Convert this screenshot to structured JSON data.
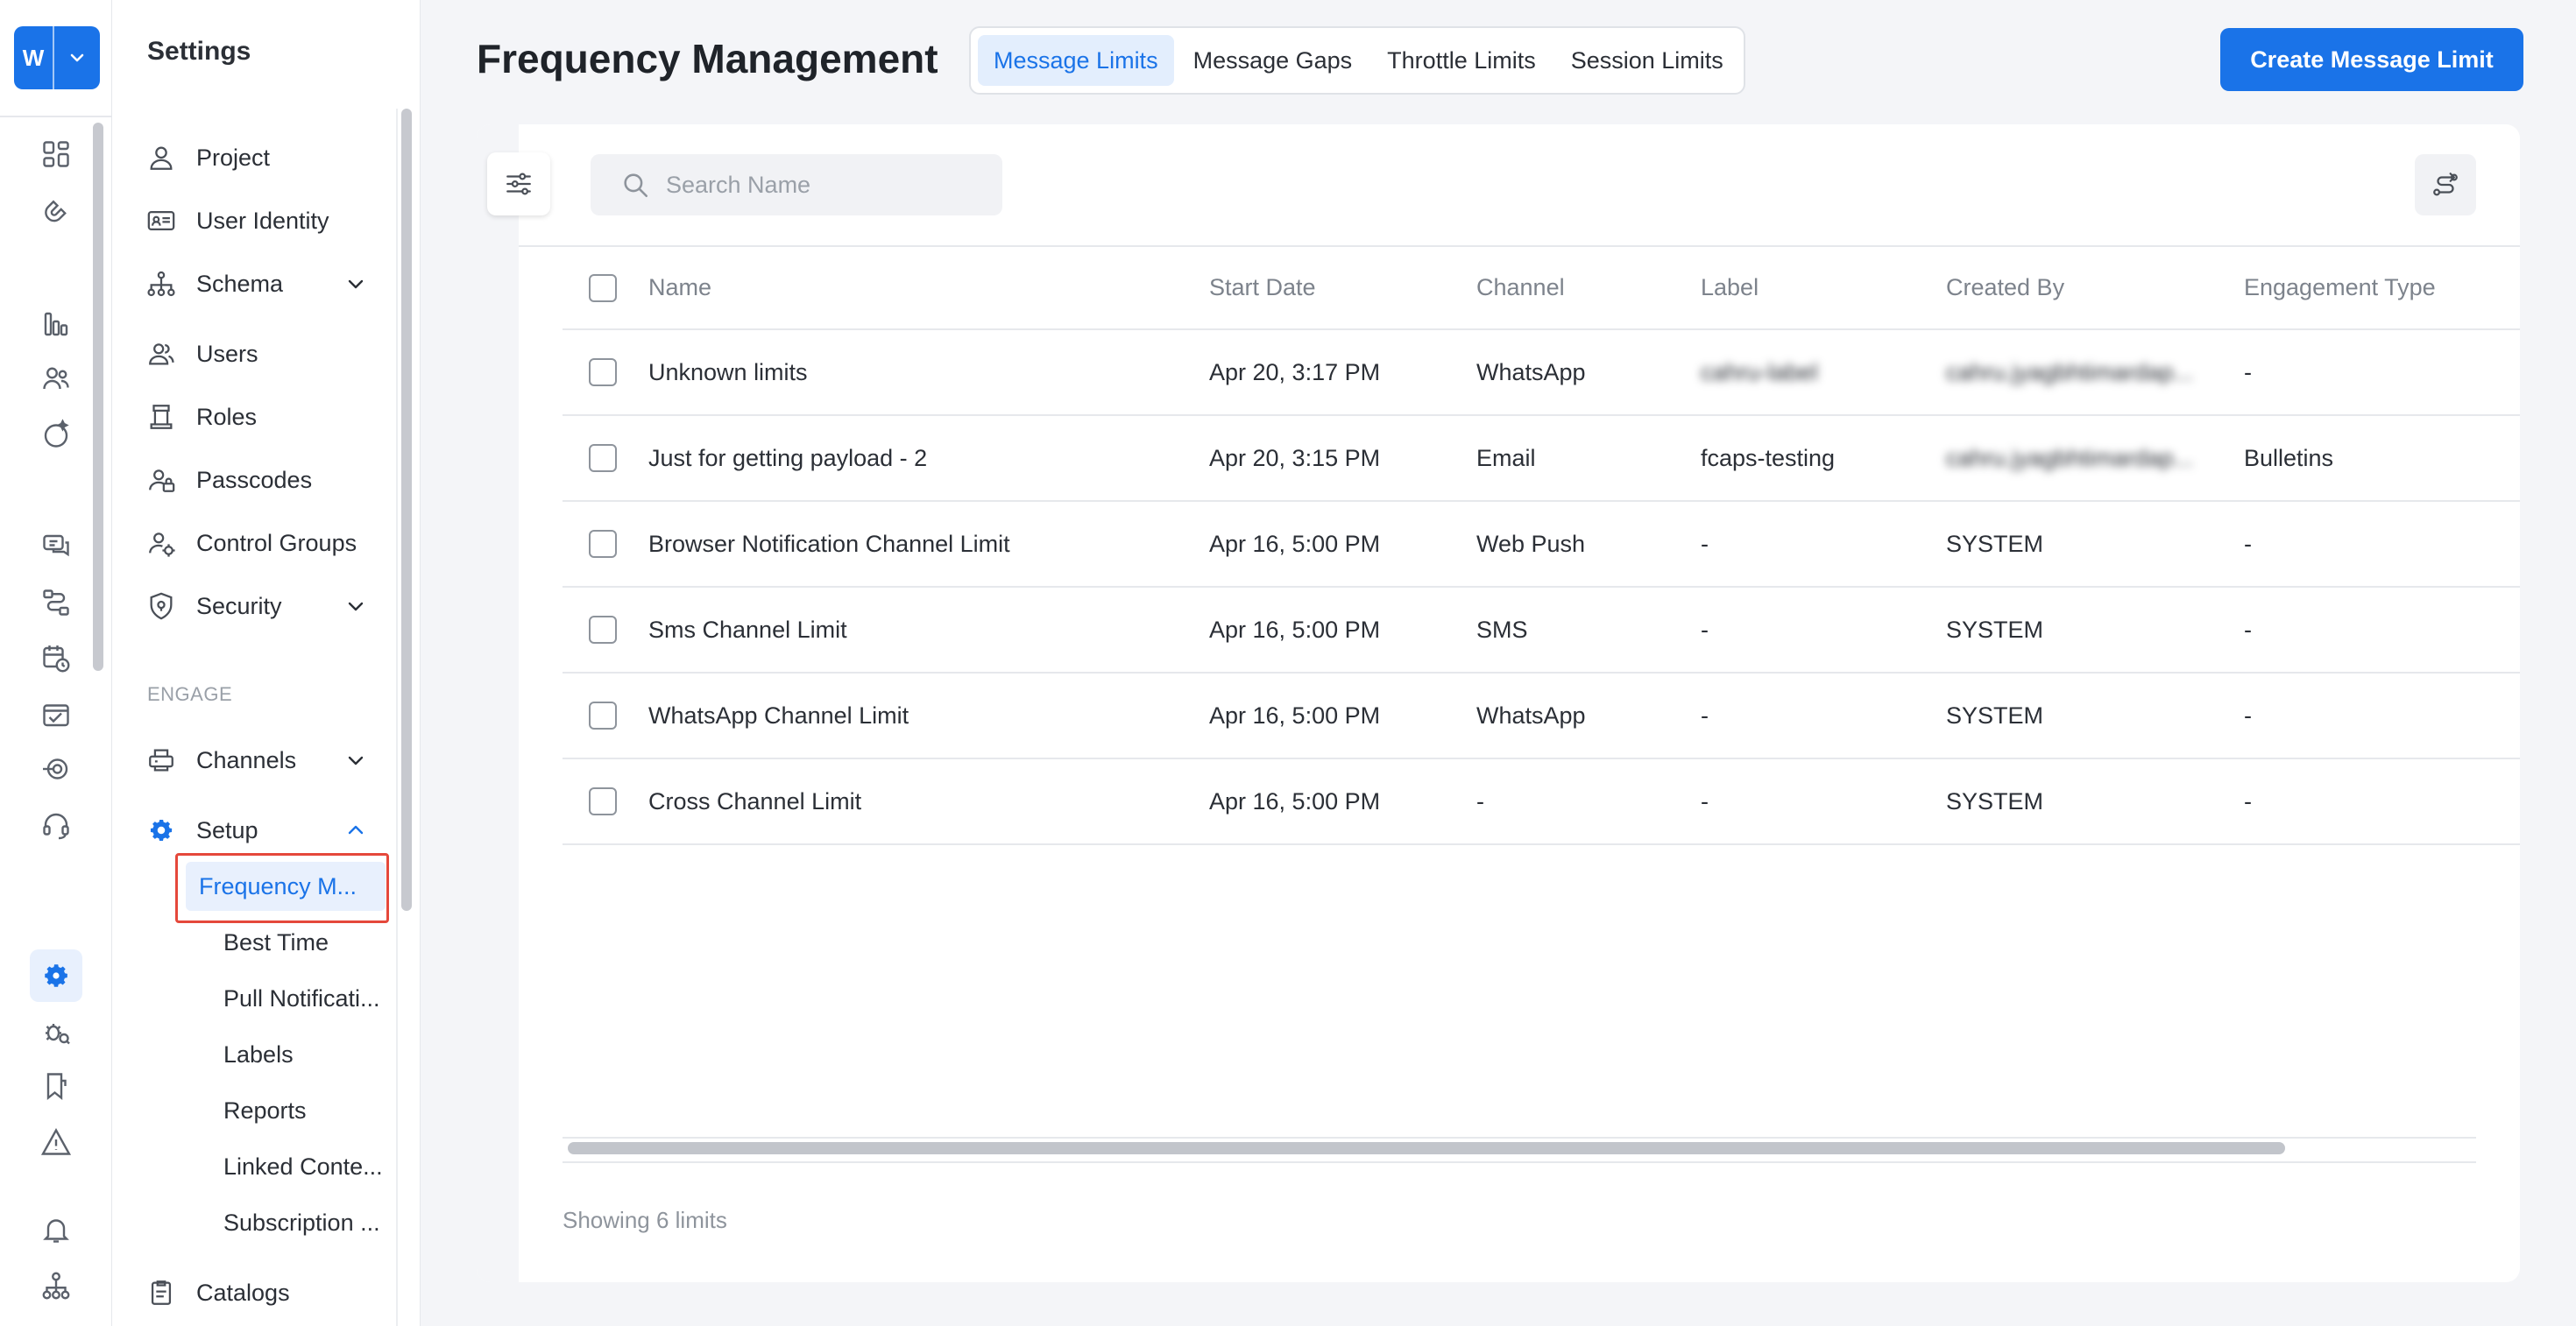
{
  "workspace": {
    "letter": "W"
  },
  "panel": {
    "title": "Settings",
    "items": [
      {
        "label": "Project",
        "icon": "person-icon"
      },
      {
        "label": "User Identity",
        "icon": "id-card-icon"
      },
      {
        "label": "Schema",
        "icon": "hierarchy-icon",
        "expandable": true
      },
      {
        "label": "Users",
        "icon": "users-icon"
      },
      {
        "label": "Roles",
        "icon": "roles-icon"
      },
      {
        "label": "Passcodes",
        "icon": "passcodes-icon"
      },
      {
        "label": "Control Groups",
        "icon": "control-groups-icon"
      },
      {
        "label": "Security",
        "icon": "shield-icon",
        "expandable": true
      }
    ],
    "section_label": "ENGAGE",
    "engage_items": [
      {
        "label": "Channels",
        "icon": "channels-icon",
        "expandable": true
      },
      {
        "label": "Setup",
        "icon": "gear-icon",
        "expanded": true
      }
    ],
    "setup_subitems": [
      "Frequency M...",
      "Best Time",
      "Pull Notificati...",
      "Labels",
      "Reports",
      "Linked Conte...",
      "Subscription ..."
    ],
    "bottom_item": {
      "label": "Catalogs",
      "icon": "catalog-icon"
    }
  },
  "header": {
    "title": "Frequency Management",
    "tabs": [
      "Message Limits",
      "Message Gaps",
      "Throttle Limits",
      "Session Limits"
    ],
    "active_tab": "Message Limits",
    "create_button": "Create Message Limit"
  },
  "search": {
    "placeholder": "Search Name"
  },
  "table": {
    "columns": [
      "Name",
      "Start Date",
      "Channel",
      "Label",
      "Created By",
      "Engagement Type"
    ],
    "rows": [
      {
        "name": "Unknown limits",
        "start": "Apr 20, 3:17 PM",
        "channel": "WhatsApp",
        "label": "cahru-label",
        "created_by": "cahru.jyagbhtimardap...",
        "engagement": "-",
        "label_blurred": true,
        "creator_blurred": true
      },
      {
        "name": "Just for getting payload - 2",
        "start": "Apr 20, 3:15 PM",
        "channel": "Email",
        "label": "fcaps-testing",
        "created_by": "cahru.jyagbhtimardap...",
        "engagement": "Bulletins",
        "label_blurred": false,
        "creator_blurred": true
      },
      {
        "name": "Browser Notification Channel Limit",
        "start": "Apr 16, 5:00 PM",
        "channel": "Web Push",
        "label": "-",
        "created_by": "SYSTEM",
        "engagement": "-"
      },
      {
        "name": "Sms Channel Limit",
        "start": "Apr 16, 5:00 PM",
        "channel": "SMS",
        "label": "-",
        "created_by": "SYSTEM",
        "engagement": "-"
      },
      {
        "name": "WhatsApp Channel Limit",
        "start": "Apr 16, 5:00 PM",
        "channel": "WhatsApp",
        "label": "-",
        "created_by": "SYSTEM",
        "engagement": "-"
      },
      {
        "name": "Cross Channel Limit",
        "start": "Apr 16, 5:00 PM",
        "channel": "-",
        "label": "-",
        "created_by": "SYSTEM",
        "engagement": "-"
      }
    ]
  },
  "footer": {
    "text": "Showing 6 limits"
  },
  "colors": {
    "accent": "#1a73e8",
    "highlight": "#e5483b"
  }
}
